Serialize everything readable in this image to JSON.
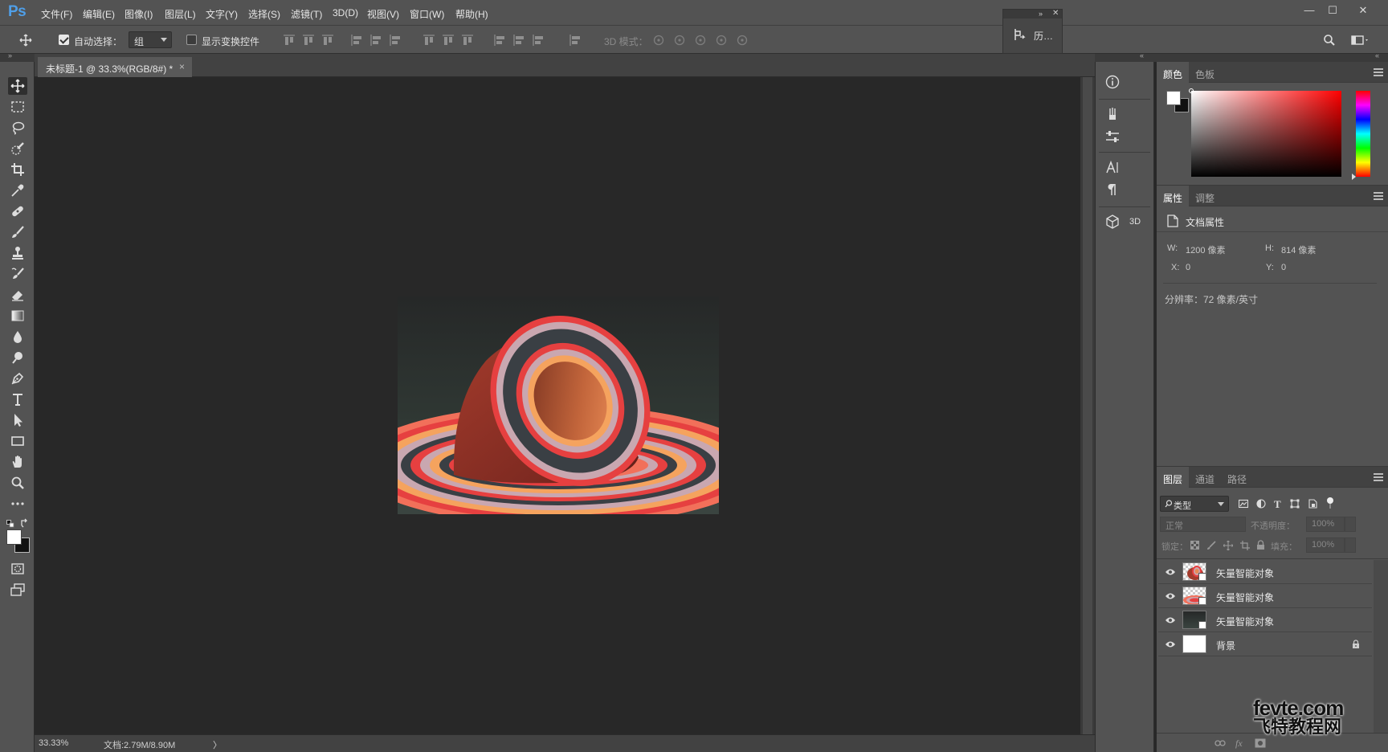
{
  "app": {
    "logo": "Ps"
  },
  "menu": [
    "文件(F)",
    "编辑(E)",
    "图像(I)",
    "图层(L)",
    "文字(Y)",
    "选择(S)",
    "滤镜(T)",
    "3D(D)",
    "视图(V)",
    "窗口(W)",
    "帮助(H)"
  ],
  "window_controls": {
    "minimize": "—",
    "maximize": "☐",
    "close": "✕"
  },
  "options": {
    "auto_select_label": "自动选择：",
    "auto_select_checked": true,
    "group_value": "组",
    "transform_controls_label": "显示变换控件",
    "transform_controls_checked": false,
    "mode_3d_label": "3D 模式：",
    "mini_history_label": "历…"
  },
  "document": {
    "tab_title": "未标题-1 @ 33.3%(RGB/8#) *",
    "tab_close": "×",
    "zoom": "33.33%",
    "doc_info": "文档:2.79M/8.90M",
    "status_arrow": "〉"
  },
  "strip": {
    "btn_3d": "3D"
  },
  "color_panel": {
    "tabs": [
      "颜色",
      "色板"
    ],
    "active_tab": 0,
    "hue_color": "#ff0000"
  },
  "properties_panel": {
    "tabs": [
      "属性",
      "调整"
    ],
    "active_tab": 0,
    "section_title": "文档属性",
    "w_label": "W:",
    "w_value": "1200 像素",
    "h_label": "H:",
    "h_value": "814 像素",
    "x_label": "X:",
    "x_value": "0",
    "y_label": "Y:",
    "y_value": "0",
    "resolution": "分辨率：72 像素/英寸"
  },
  "layers_panel": {
    "tabs": [
      "图层",
      "通道",
      "路径"
    ],
    "active_tab": 0,
    "filter_kind": "类型",
    "blend_mode": "正常",
    "opacity_label": "不透明度：",
    "opacity_value": "100%",
    "lock_label": "锁定：",
    "fill_label": "填充：",
    "fill_value": "100%",
    "layers": [
      {
        "name": "矢量智能对象",
        "visible": true
      },
      {
        "name": "矢量智能对象",
        "visible": true
      },
      {
        "name": "矢量智能对象",
        "visible": true
      },
      {
        "name": "背景",
        "visible": true,
        "locked": true
      }
    ],
    "footer_icons": [
      "link-icon",
      "fx-icon",
      "mask-icon"
    ]
  },
  "watermark": {
    "line1": "fevte.com",
    "line2": "飞特教程网"
  }
}
